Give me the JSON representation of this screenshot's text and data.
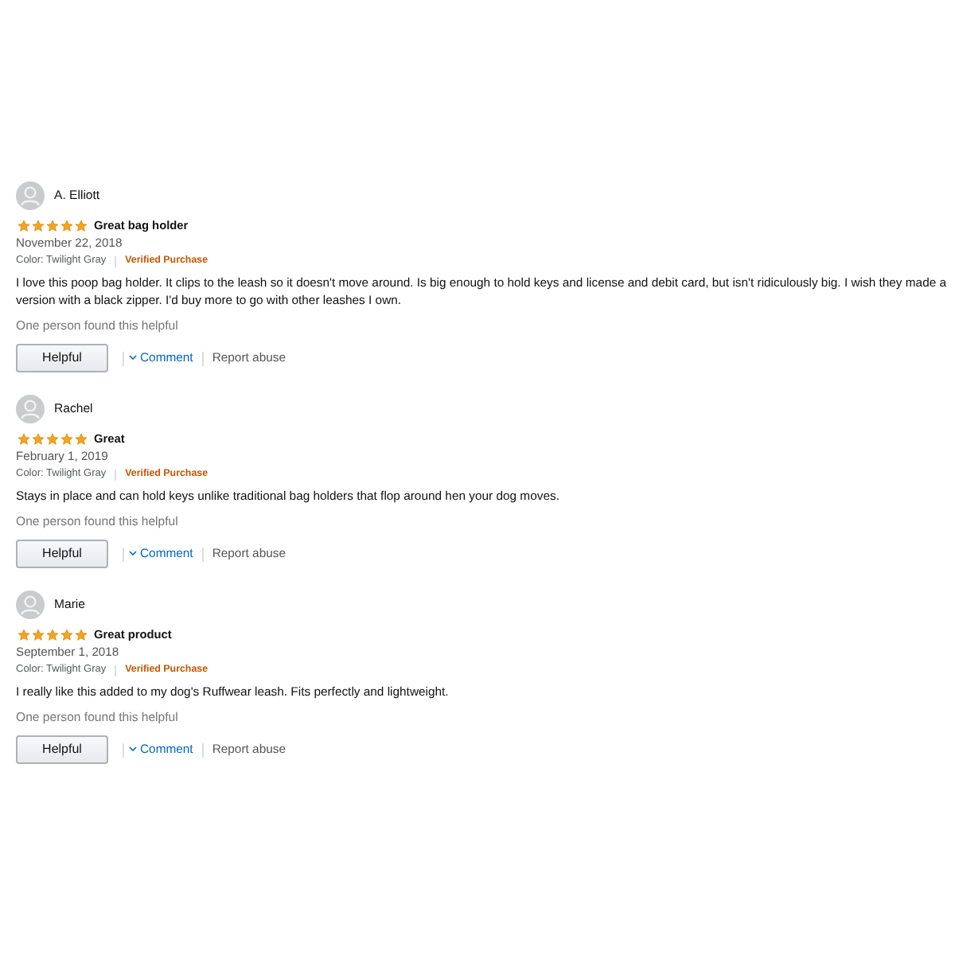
{
  "reviews": [
    {
      "reviewer": "A. Elliott",
      "stars": 5,
      "title": "Great bag holder",
      "date": "November 22, 2018",
      "variant": "Color: Twilight Gray",
      "badge": "Verified Purchase",
      "body": "I love this poop bag holder. It clips to the leash so it doesn't move around. Is big enough to hold keys and license and debit card, but isn't ridiculously big. I wish they made a version with a black zipper. I'd buy more to go with other leashes I own.",
      "helpful_note": "One person found this helpful",
      "helpful_button": "Helpful",
      "comment_link": "Comment",
      "report_link": "Report abuse"
    },
    {
      "reviewer": "Rachel",
      "stars": 5,
      "title": "Great",
      "date": "February 1, 2019",
      "variant": "Color: Twilight Gray",
      "badge": "Verified Purchase",
      "body": "Stays in place and can hold keys unlike traditional bag holders that flop around hen your dog moves.",
      "helpful_note": "One person found this helpful",
      "helpful_button": "Helpful",
      "comment_link": "Comment",
      "report_link": "Report abuse"
    },
    {
      "reviewer": "Marie",
      "stars": 5,
      "title": "Great product",
      "date": "September 1, 2018",
      "variant": "Color: Twilight Gray",
      "badge": "Verified Purchase",
      "body": "I really like this added to my dog's Ruffwear leash. Fits perfectly and lightweight.",
      "helpful_note": "One person found this helpful",
      "helpful_button": "Helpful",
      "comment_link": "Comment",
      "report_link": "Report abuse"
    }
  ]
}
